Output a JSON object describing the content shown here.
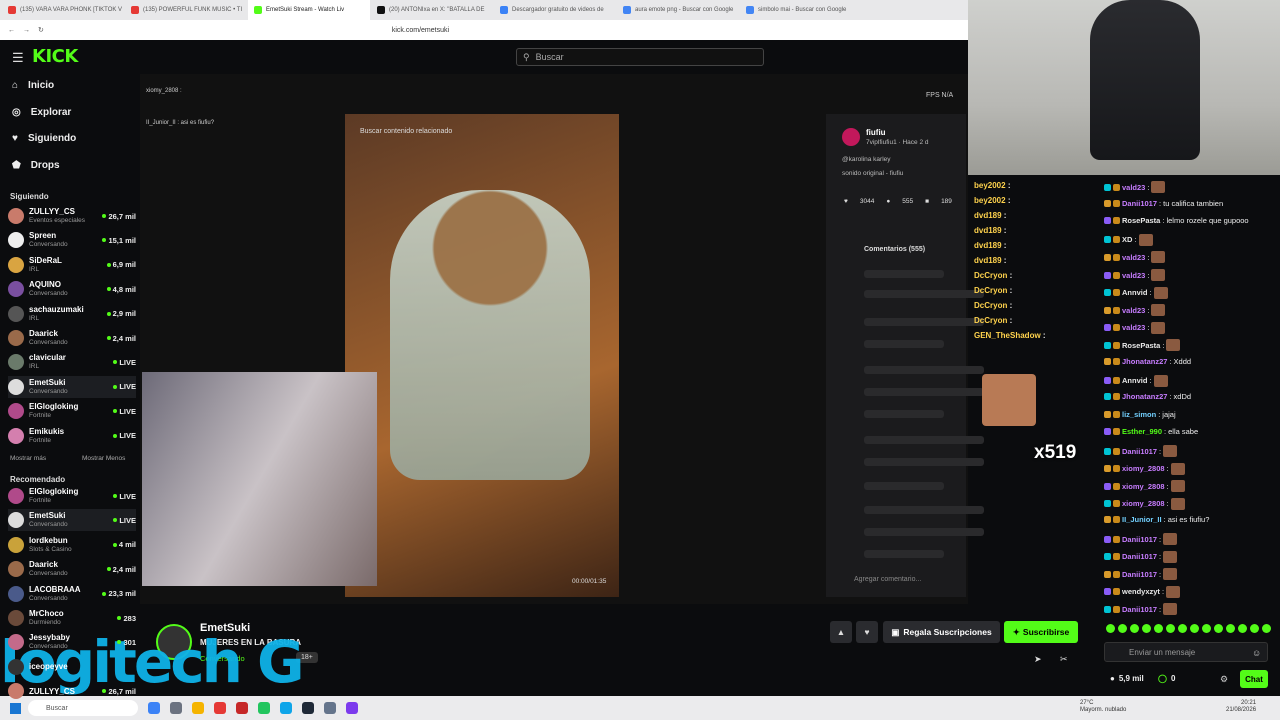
{
  "browser": {
    "tabs": [
      {
        "label": "(135) VARA VARA PHONK [TIKTOK V",
        "color": "#e53935"
      },
      {
        "label": "(135) POWERFUL FUNK MUSIC • TI",
        "color": "#e53935"
      },
      {
        "label": "EmetSuki Stream - Watch Liv",
        "color": "#53fc18"
      },
      {
        "label": "(20) ANTONIxa en X: \"BATALLA DE",
        "color": "#111111"
      },
      {
        "label": "Descargador gratuito de videos de",
        "color": "#3b82f6"
      },
      {
        "label": "aura emote png - Buscar con Google",
        "color": "#4285f4"
      },
      {
        "label": "simbolo mai - Buscar con Google",
        "color": "#4285f4"
      }
    ],
    "url": "kick.com/emetsuki"
  },
  "kick": {
    "logo": "KICK",
    "search_placeholder": "Buscar",
    "nav": [
      {
        "label": "Inicio",
        "icon": "home-icon"
      },
      {
        "label": "Explorar",
        "icon": "compass-icon"
      },
      {
        "label": "Siguiendo",
        "icon": "heart-icon"
      },
      {
        "label": "Drops",
        "icon": "drops-icon"
      }
    ],
    "following_title": "Siguiendo",
    "following": [
      {
        "name": "ZULLYY_CS",
        "cat": "Eventos especiales",
        "viewers": "26,7 mil",
        "color": "#c97b6b"
      },
      {
        "name": "Spreen",
        "cat": "Conversando",
        "viewers": "15,1 mil",
        "color": "#eeeeee"
      },
      {
        "name": "SiDeRaL",
        "cat": "IRL",
        "viewers": "6,9 mil",
        "color": "#d9a441"
      },
      {
        "name": "AQUINO",
        "cat": "Conversando",
        "viewers": "4,8 mil",
        "color": "#7a4fa0"
      },
      {
        "name": "sachauzumaki",
        "cat": "IRL",
        "viewers": "2,9 mil",
        "color": "#555555"
      },
      {
        "name": "Daarick",
        "cat": "Conversando",
        "viewers": "2,4 mil",
        "color": "#9a6a4a"
      },
      {
        "name": "clavicular",
        "cat": "IRL",
        "viewers": "LIVE",
        "color": "#6a7a6a"
      },
      {
        "name": "EmetSuki",
        "cat": "Conversando",
        "viewers": "LIVE",
        "color": "#dddddd"
      },
      {
        "name": "ElGlogloking",
        "cat": "Fortnite",
        "viewers": "LIVE",
        "color": "#b04a8a"
      },
      {
        "name": "Emikukis",
        "cat": "Fortnite",
        "viewers": "LIVE",
        "color": "#d47fae"
      }
    ],
    "show_more": "Mostrar más",
    "show_less": "Mostrar Menos",
    "recommended_title": "Recomendado",
    "recommended": [
      {
        "name": "ElGlogloking",
        "cat": "Fortnite",
        "viewers": "LIVE",
        "color": "#b04a8a"
      },
      {
        "name": "EmetSuki",
        "cat": "Conversando",
        "viewers": "LIVE",
        "color": "#dddddd"
      },
      {
        "name": "lordkebun",
        "cat": "Slots & Casino",
        "viewers": "4 mil",
        "color": "#c9a23a"
      },
      {
        "name": "Daarick",
        "cat": "Conversando",
        "viewers": "2,4 mil",
        "color": "#9a6a4a"
      },
      {
        "name": "LACOBRAAA",
        "cat": "Conversando",
        "viewers": "23,3 mil",
        "color": "#4a5a8a"
      },
      {
        "name": "MrChoco",
        "cat": "Durmiendo",
        "viewers": "283",
        "color": "#6a4a3a"
      },
      {
        "name": "Jessybaby",
        "cat": "Conversando",
        "viewers": "301",
        "color": "#c46a8a"
      },
      {
        "name": "iceopeyve",
        "cat": "",
        "viewers": "",
        "color": "#333333"
      },
      {
        "name": "ZULLYY_CS",
        "cat": "",
        "viewers": "26,7 mil",
        "color": "#c97b6b"
      }
    ]
  },
  "video": {
    "tiktok_handle": "fiufiu",
    "tiktok_sub": "7viplfiufiu1 · Hace 2 d",
    "tiktok_user": "@karolina karley",
    "tiktok_sound": "sonido original - fiufiu",
    "likes": "3044",
    "comments": "555",
    "saves": "189",
    "comments_title": "Comentarios (555)",
    "add_comment": "Agregar comentario...",
    "search_related": "Buscar contenido relacionado",
    "time": "00:00/01:35",
    "fps": "FPS N/A",
    "combo": "x519",
    "overlay_chat": [
      [
        "bey2002",
        ""
      ],
      [
        "bey2002",
        ""
      ],
      [
        "dvd189",
        ""
      ],
      [
        "dvd189",
        ""
      ],
      [
        "dvd189",
        ""
      ],
      [
        "dvd189",
        ""
      ],
      [
        "DcCryon",
        ""
      ],
      [
        "DcCryon",
        ""
      ],
      [
        "DcCryon",
        ""
      ],
      [
        "DcCryon",
        ""
      ],
      [
        "GEN_TheShadow",
        ""
      ]
    ],
    "mini_chat": [
      "xiomy_2808 :",
      "II_Junior_II : asi es fiufiu?"
    ]
  },
  "stream": {
    "channel": "EmetSuki",
    "title": "MUJERES EN LA BASURA",
    "category": "Conversando",
    "age": "18+",
    "sub_btn": "Suscribirse",
    "gift_btn": "Regala Suscripciones"
  },
  "watermark": "logitech G",
  "chat": {
    "messages": [
      {
        "user": "vald23",
        "text": "",
        "color": "#c77dff"
      },
      {
        "user": "Danii1017",
        "text": "tu califica tambien",
        "color": "#c77dff"
      },
      {
        "user": "RosePasta",
        "text": "lelmo rozele que gupooo",
        "color": "#e9e9e9"
      },
      {
        "user": "XD",
        "text": "",
        "color": "#e9e9e9"
      },
      {
        "user": "vald23",
        "text": "",
        "color": "#c77dff"
      },
      {
        "user": "vald23",
        "text": "",
        "color": "#c77dff"
      },
      {
        "user": "Annvid",
        "text": "",
        "color": "#e9e9e9"
      },
      {
        "user": "vald23",
        "text": "",
        "color": "#c77dff"
      },
      {
        "user": "vald23",
        "text": "",
        "color": "#c77dff"
      },
      {
        "user": "RosePasta",
        "text": "",
        "color": "#e9e9e9"
      },
      {
        "user": "Jhonatanz27",
        "text": "Xddd",
        "color": "#c77dff"
      },
      {
        "user": "Annvid",
        "text": "",
        "color": "#e9e9e9"
      },
      {
        "user": "Jhonatanz27",
        "text": "xdDd",
        "color": "#c77dff"
      },
      {
        "user": "liz_simon",
        "text": "jajaj",
        "color": "#72d0ff"
      },
      {
        "user": "Esther_990",
        "text": "ella sabe",
        "color": "#53fc18"
      },
      {
        "user": "Danii1017",
        "text": "",
        "color": "#c77dff"
      },
      {
        "user": "xiomy_2808",
        "text": "",
        "color": "#c77dff"
      },
      {
        "user": "xiomy_2808",
        "text": "",
        "color": "#c77dff"
      },
      {
        "user": "xiomy_2808",
        "text": "",
        "color": "#c77dff"
      },
      {
        "user": "II_Junior_II",
        "text": "asi es fiufiu?",
        "color": "#72d0ff"
      },
      {
        "user": "Danii1017",
        "text": "",
        "color": "#c77dff"
      },
      {
        "user": "Danii1017",
        "text": "",
        "color": "#c77dff"
      },
      {
        "user": "Danii1017",
        "text": "",
        "color": "#c77dff"
      },
      {
        "user": "wendyxzyt",
        "text": "",
        "color": "#e9e9e9"
      },
      {
        "user": "Danii1017",
        "text": "",
        "color": "#c77dff"
      }
    ],
    "input_placeholder": "Enviar un mensaje",
    "viewers": "5,9 mil",
    "points": "0",
    "send_btn": "Chat"
  },
  "taskbar": {
    "search": "Buscar",
    "weather_temp": "27°C",
    "weather_desc": "Mayorm. nublado",
    "lang": "ESP\nLAA",
    "time": "20:21",
    "date": "21/08/2026"
  }
}
